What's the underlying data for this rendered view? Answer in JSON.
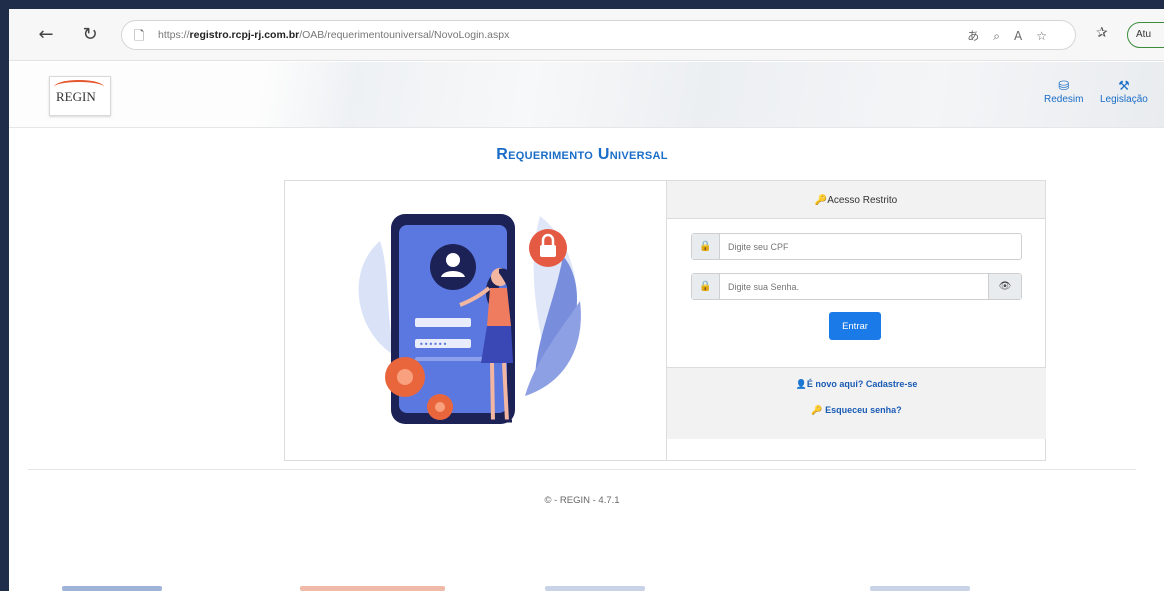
{
  "browser": {
    "url_prefix": "https://",
    "url_host": "registro.rcpj-rj.com.br",
    "url_path": "/OAB/requerimentouniversal/NovoLogin.aspx",
    "profile_label": "Atu"
  },
  "header": {
    "logo_text": "REGIN",
    "links": [
      {
        "label": "Redesim",
        "icon": "sitemap-icon"
      },
      {
        "label": "Legislação",
        "icon": "gavel-icon"
      }
    ]
  },
  "page": {
    "title": "Requerimento Universal"
  },
  "login": {
    "heading": "Acesso Restrito",
    "cpf_placeholder": "Digite seu CPF",
    "password_placeholder": "Digite sua Senha.",
    "submit_label": "Entrar",
    "register_link": "É novo aqui? Cadastre-se",
    "forgot_link": "Esqueceu senha?"
  },
  "footer": {
    "copyright": "© - REGIN - 4.7.1"
  },
  "colors": {
    "accent": "#1a6dc8",
    "button": "#1a7ae8",
    "frame": "#1f2d4a"
  }
}
